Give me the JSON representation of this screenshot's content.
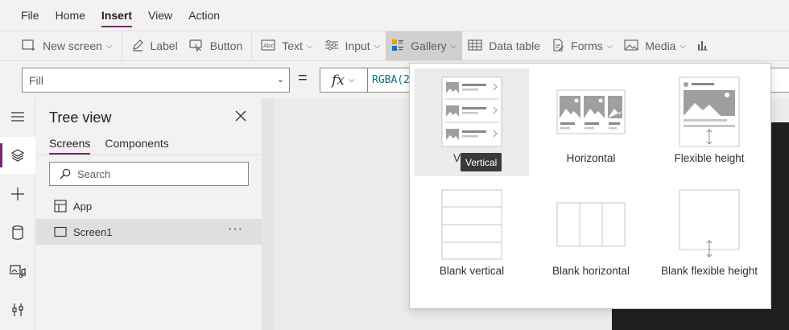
{
  "menu": {
    "items": [
      "File",
      "Home",
      "Insert",
      "View",
      "Action"
    ],
    "active": "Insert"
  },
  "ribbon": {
    "new_screen": "New screen",
    "label": "Label",
    "button": "Button",
    "text": "Text",
    "input": "Input",
    "gallery": "Gallery",
    "data_table": "Data table",
    "forms": "Forms",
    "media": "Media"
  },
  "formula": {
    "property": "Fill",
    "equals": "=",
    "fx": "fx",
    "value": "RGBA(2"
  },
  "tree": {
    "title": "Tree view",
    "tabs": [
      "Screens",
      "Components"
    ],
    "search_placeholder": "Search",
    "items": [
      {
        "label": "App"
      },
      {
        "label": "Screen1",
        "more": "···"
      }
    ]
  },
  "gallery_menu": {
    "options": [
      {
        "label": "Vertical"
      },
      {
        "label": "Horizontal"
      },
      {
        "label": "Flexible height"
      },
      {
        "label": "Blank vertical"
      },
      {
        "label": "Blank horizontal"
      },
      {
        "label": "Blank flexible height"
      }
    ],
    "tooltip": "Vertical",
    "hovered_label_fragment": "V"
  },
  "colors": {
    "accent": "#742774",
    "formula_text": "#0f6c85",
    "dark_panel": "#201f1e"
  }
}
